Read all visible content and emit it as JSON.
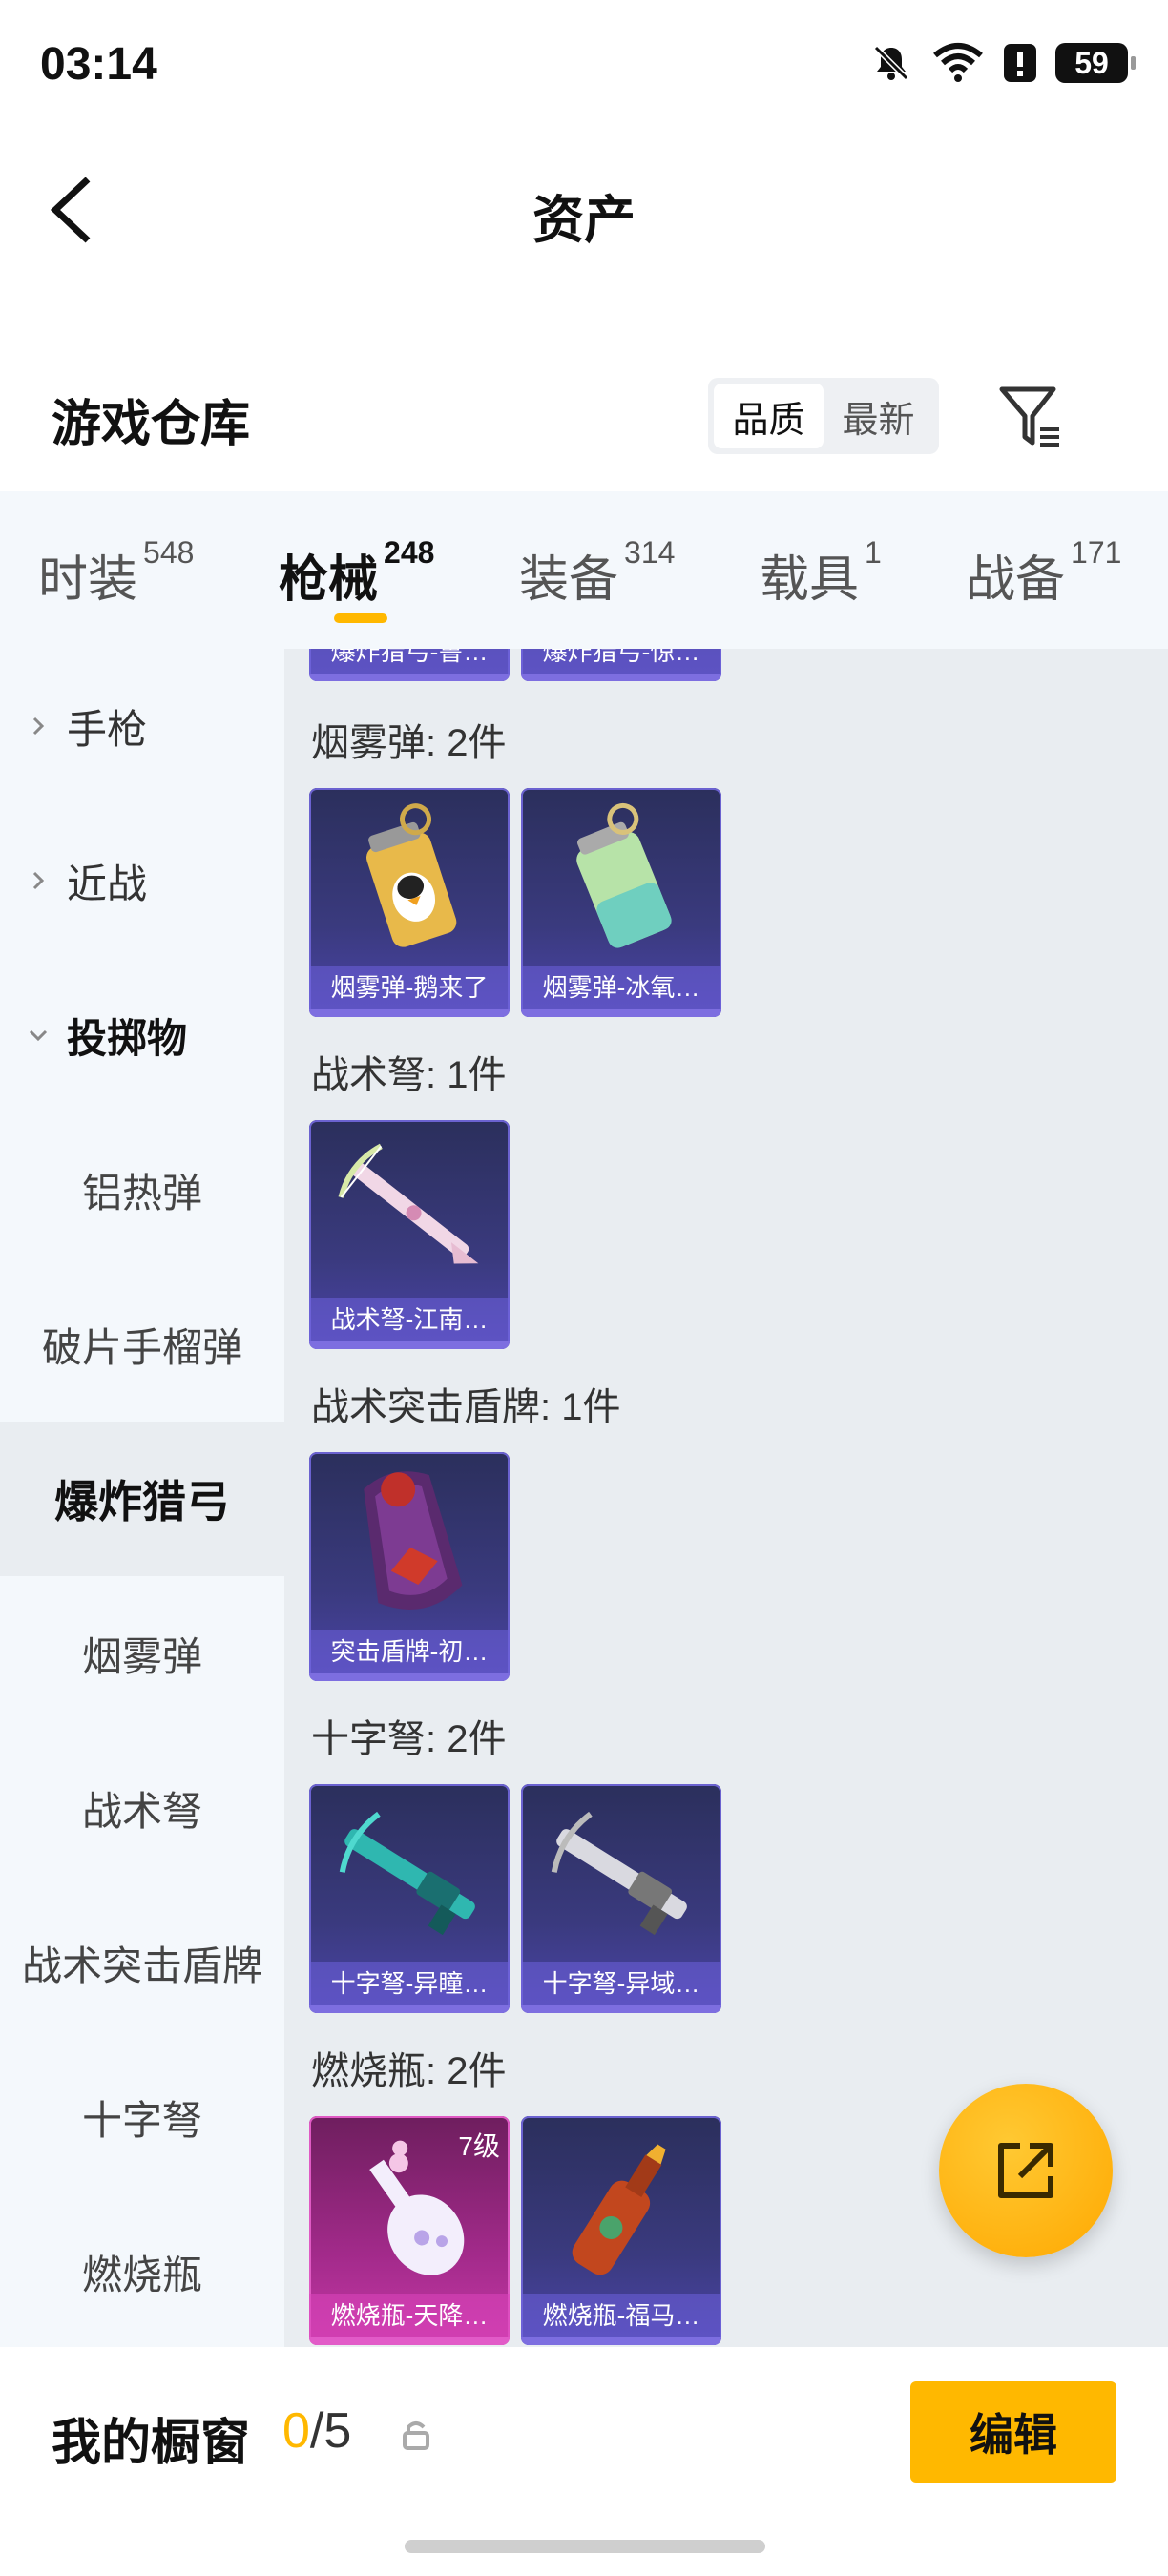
{
  "status_bar": {
    "time": "03:14",
    "battery": "59"
  },
  "header": {
    "title": "资产"
  },
  "warehouse": {
    "title": "游戏仓库",
    "sort_options": [
      {
        "label": "品质",
        "active": true
      },
      {
        "label": "最新",
        "active": false
      }
    ]
  },
  "tabs": [
    {
      "label": "时装",
      "count": "548",
      "active": false
    },
    {
      "label": "枪械",
      "count": "248",
      "active": true
    },
    {
      "label": "装备",
      "count": "314",
      "active": false
    },
    {
      "label": "载具",
      "count": "1",
      "active": false
    },
    {
      "label": "战备",
      "count": "171",
      "active": false
    }
  ],
  "sidebar": {
    "items": [
      {
        "label": "手枪",
        "kind": "group"
      },
      {
        "label": "近战",
        "kind": "group"
      },
      {
        "label": "投掷物",
        "kind": "group-open"
      },
      {
        "label": "铝热弹",
        "kind": "sub"
      },
      {
        "label": "破片手榴弹",
        "kind": "sub"
      },
      {
        "label": "爆炸猎弓",
        "kind": "sub-selected"
      },
      {
        "label": "烟雾弹",
        "kind": "sub"
      },
      {
        "label": "战术弩",
        "kind": "sub"
      },
      {
        "label": "战术突击盾牌",
        "kind": "sub"
      },
      {
        "label": "十字弩",
        "kind": "sub"
      },
      {
        "label": "燃烧瓶",
        "kind": "sub"
      }
    ]
  },
  "content": {
    "partial_top_cards": [
      "爆炸猎弓-鲁…",
      "爆炸猎弓-惊…"
    ],
    "sections": [
      {
        "heading": "烟雾弹: 2件",
        "cards": [
          {
            "name": "烟雾弹-鹅来了",
            "rarity": "epic",
            "icon": "smoke-grenade-icon"
          },
          {
            "name": "烟雾弹-冰氧…",
            "rarity": "epic",
            "icon": "smoke-grenade-icon"
          }
        ]
      },
      {
        "heading": "战术弩: 1件",
        "cards": [
          {
            "name": "战术弩-江南…",
            "rarity": "epic",
            "icon": "crossbow-icon"
          }
        ]
      },
      {
        "heading": "战术突击盾牌: 1件",
        "cards": [
          {
            "name": "突击盾牌-初…",
            "rarity": "epic",
            "icon": "shield-icon"
          }
        ]
      },
      {
        "heading": "十字弩: 2件",
        "cards": [
          {
            "name": "十字弩-异瞳…",
            "rarity": "epic",
            "icon": "crossbow-icon"
          },
          {
            "name": "十字弩-异域…",
            "rarity": "epic",
            "icon": "crossbow-icon"
          }
        ]
      },
      {
        "heading": "燃烧瓶: 2件",
        "cards": [
          {
            "name": "燃烧瓶-天降…",
            "rarity": "legendary",
            "level": "7级",
            "icon": "molotov-icon"
          },
          {
            "name": "燃烧瓶-福马…",
            "rarity": "epic",
            "icon": "molotov-icon"
          }
        ]
      }
    ]
  },
  "showcase": {
    "title": "我的橱窗",
    "current": "0",
    "total": "/5",
    "edit_label": "编辑"
  },
  "colors": {
    "accent": "#ffb800",
    "epic": "#4b44a8",
    "legendary": "#c538a6"
  }
}
